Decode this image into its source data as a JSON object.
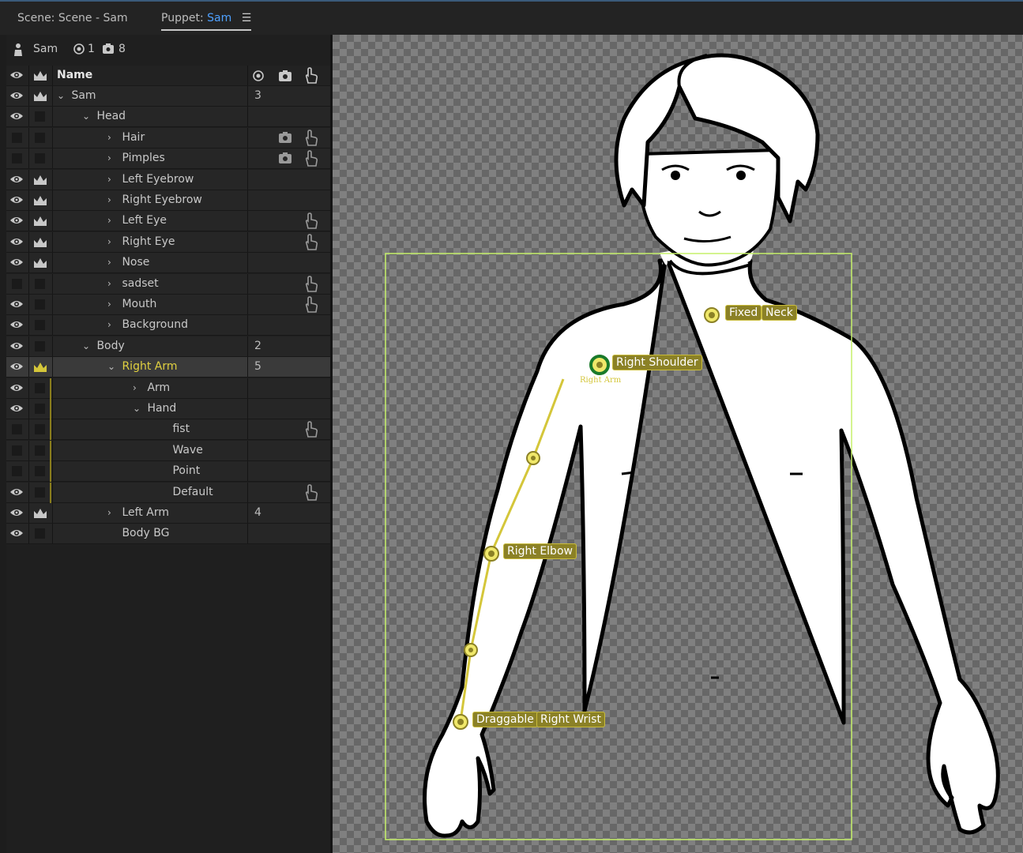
{
  "tabs": {
    "scene_label": "Scene:",
    "scene_name": "Scene - Sam",
    "puppet_label": "Puppet:",
    "puppet_name": "Sam",
    "menu_icon": "hamburger-icon"
  },
  "puppet_info": {
    "name": "Sam",
    "handle_count": "1",
    "trigger_count": "8"
  },
  "header": {
    "name": "Name"
  },
  "rows": [
    {
      "label": "Sam",
      "count": "3",
      "eye": true,
      "crown": true,
      "chevron": "down"
    },
    {
      "label": "Head",
      "count": "",
      "eye": true,
      "crown": false,
      "chevron": "down"
    },
    {
      "label": "Hair",
      "count": "",
      "eye": false,
      "crown": false,
      "chevron": "right"
    },
    {
      "label": "Pimples",
      "count": "",
      "eye": false,
      "crown": false,
      "chevron": "right"
    },
    {
      "label": "Left Eyebrow",
      "count": "",
      "eye": true,
      "crown": true,
      "chevron": "right"
    },
    {
      "label": "Right Eyebrow",
      "count": "",
      "eye": true,
      "crown": true,
      "chevron": "right"
    },
    {
      "label": "Left Eye",
      "count": "",
      "eye": true,
      "crown": true,
      "chevron": "right"
    },
    {
      "label": "Right Eye",
      "count": "",
      "eye": true,
      "crown": true,
      "chevron": "right"
    },
    {
      "label": "Nose",
      "count": "",
      "eye": true,
      "crown": true,
      "chevron": "right"
    },
    {
      "label": "sadset",
      "count": "",
      "eye": false,
      "crown": false,
      "chevron": "right"
    },
    {
      "label": "Mouth",
      "count": "",
      "eye": true,
      "crown": false,
      "chevron": "right"
    },
    {
      "label": "Background",
      "count": "",
      "eye": true,
      "crown": false,
      "chevron": "right"
    },
    {
      "label": "Body",
      "count": "2",
      "eye": true,
      "crown": false,
      "chevron": "down"
    },
    {
      "label": "Right Arm",
      "count": "5",
      "eye": true,
      "crown": true,
      "chevron": "down",
      "selected": true
    },
    {
      "label": "Arm",
      "count": "",
      "eye": true,
      "crown": false,
      "chevron": "right"
    },
    {
      "label": "Hand",
      "count": "",
      "eye": true,
      "crown": false,
      "chevron": "down"
    },
    {
      "label": "fist",
      "count": "",
      "eye": false,
      "crown": false,
      "chevron": ""
    },
    {
      "label": "Wave",
      "count": "",
      "eye": false,
      "crown": false,
      "chevron": ""
    },
    {
      "label": "Point",
      "count": "",
      "eye": false,
      "crown": false,
      "chevron": ""
    },
    {
      "label": "Default",
      "count": "",
      "eye": true,
      "crown": false,
      "chevron": ""
    },
    {
      "label": "Left Arm",
      "count": "4",
      "eye": true,
      "crown": true,
      "chevron": "right"
    },
    {
      "label": "Body BG",
      "count": "",
      "eye": true,
      "crown": false,
      "chevron": ""
    }
  ],
  "canvas": {
    "handles": {
      "fixed": "Fixed",
      "neck": "Neck",
      "right_shoulder": "Right Shoulder",
      "right_arm_small": "Right Arm",
      "right_elbow": "Right Elbow",
      "draggable": "Draggable",
      "right_wrist": "Right Wrist"
    }
  },
  "colors": {
    "accent_blue": "#4ea0ff",
    "handle_yellow": "#d4c63a",
    "selection_box": "#c6f06a"
  }
}
